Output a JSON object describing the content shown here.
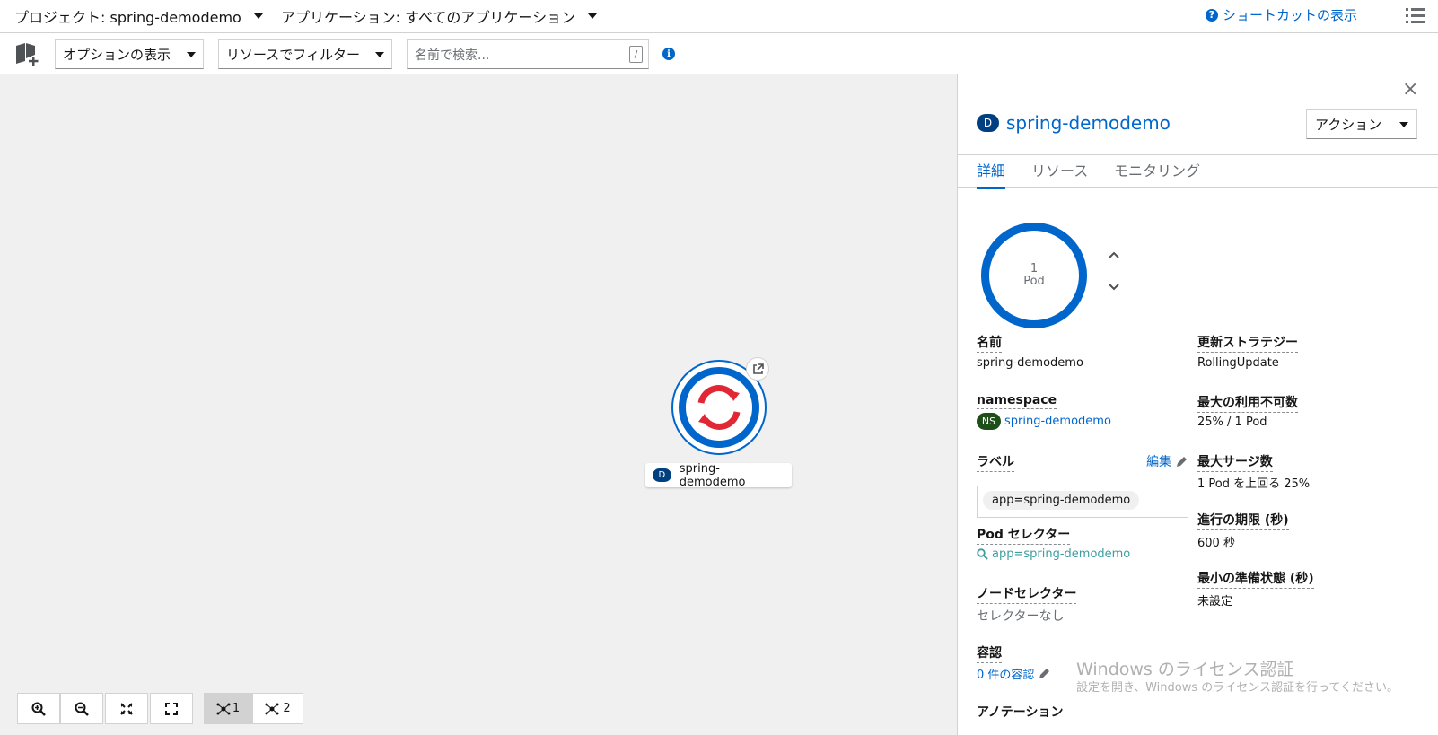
{
  "header": {
    "project_label": "プロジェクト: spring-demodemo",
    "application_label": "アプリケーション: すべてのアプリケーション",
    "shortcuts_label": "ショートカットの表示"
  },
  "toolbar": {
    "display_options": "オプションの表示",
    "filter_resources": "リソースでフィルター",
    "search_placeholder": "名前で検索...",
    "search_shortcut": "/"
  },
  "topology": {
    "node_badge": "D",
    "node_name": "spring-demodemo",
    "controls": {
      "view1": "1",
      "view2": "2"
    }
  },
  "panel": {
    "badge": "D",
    "title": "spring-demodemo",
    "actions_label": "アクション",
    "tabs": [
      "詳細",
      "リソース",
      "モニタリング"
    ],
    "pod_count": "1",
    "pod_unit": "Pod",
    "details": {
      "name_label": "名前",
      "name_value": "spring-demodemo",
      "namespace_label": "namespace",
      "namespace_badge": "NS",
      "namespace_value": "spring-demodemo",
      "labels_label": "ラベル",
      "labels_edit": "編集",
      "label_chip": "app=spring-demodemo",
      "pod_selector_label": "Pod セレクター",
      "pod_selector_value": "app=spring-demodemo",
      "node_selector_label": "ノードセレクター",
      "node_selector_value": "セレクターなし",
      "tolerations_label": "容認",
      "tolerations_value": "0 件の容認",
      "annotations_label": "アノテーション",
      "update_strategy_label": "更新ストラテジー",
      "update_strategy_value": "RollingUpdate",
      "max_unavailable_label": "最大の利用不可数",
      "max_unavailable_value": "25% / 1 Pod",
      "max_surge_label": "最大サージ数",
      "max_surge_value": "1 Pod を上回る 25%",
      "progress_deadline_label": "進行の期限 (秒)",
      "progress_deadline_value": "600 秒",
      "min_ready_label": "最小の準備状態 (秒)",
      "min_ready_value": "未設定"
    }
  },
  "watermark": {
    "line1": "Windows のライセンス認証",
    "line2": "設定を開き、Windows のライセンス認証を行ってください。"
  },
  "colors": {
    "accent": "#0066cc",
    "canvas_bg": "#f0f0f0",
    "openshift_red": "#e12634",
    "ns_badge": "#1e4f18",
    "deployment_badge": "#004080"
  }
}
